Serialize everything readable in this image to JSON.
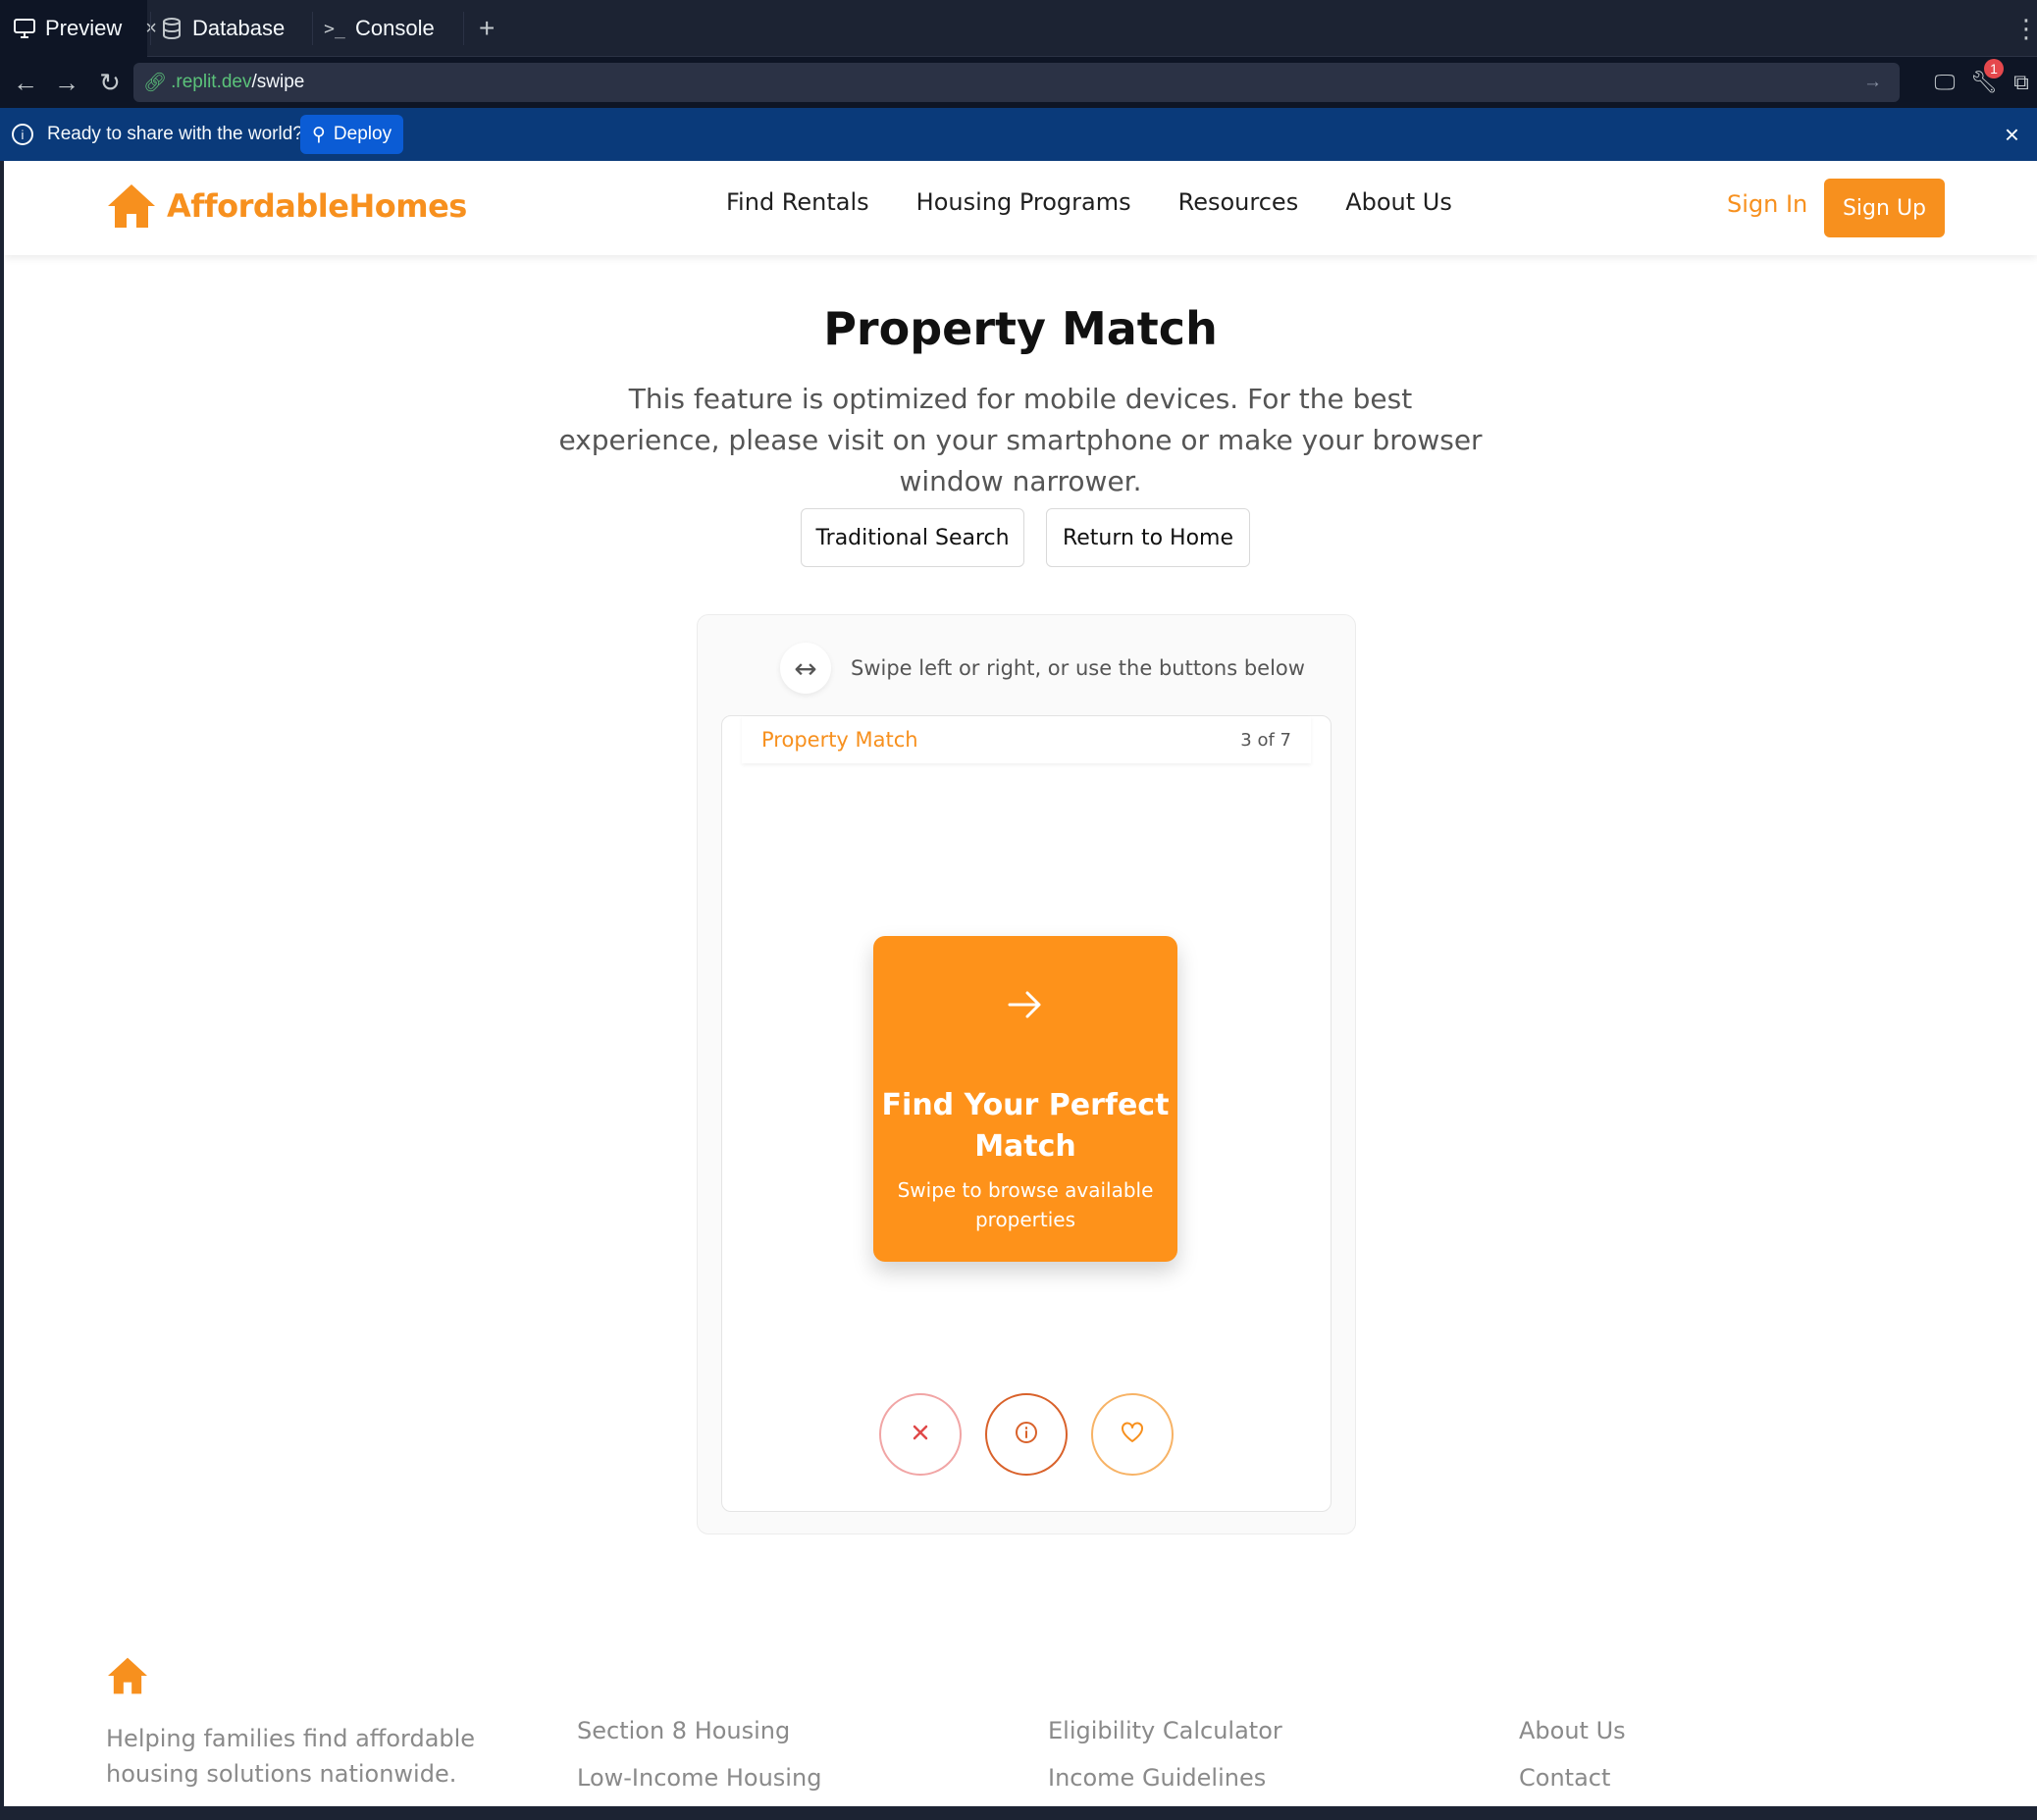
{
  "chrome": {
    "tabs": [
      {
        "label": "Preview",
        "icon": "monitor-icon"
      },
      {
        "label": "Database",
        "icon": "database-icon"
      },
      {
        "label": "Console",
        "icon": "terminal-icon"
      }
    ],
    "url": {
      "domain": ".replit.dev",
      "path": "/swipe"
    },
    "notification_count": "1",
    "deploy_bar": {
      "message": "Ready to share with the world?",
      "button": "Deploy"
    }
  },
  "site": {
    "brand": "AffordableHomes",
    "nav": [
      "Find Rentals",
      "Housing Programs",
      "Resources",
      "About Us"
    ],
    "sign_in": "Sign In",
    "sign_up": "Sign Up"
  },
  "page": {
    "title": "Property Match",
    "subtitle": "This feature is optimized for mobile devices. For the best experience, please visit on your smartphone or make your browser window narrower.",
    "buttons": {
      "traditional_search": "Traditional Search",
      "return_home": "Return to Home"
    },
    "swipe_hint": "Swipe left or right, or use the buttons below",
    "card": {
      "header_title": "Property Match",
      "counter": "3 of 7",
      "promo_title": "Find Your Perfect Match",
      "promo_text": "Swipe to browse available properties"
    },
    "colors": {
      "accent": "#f7901e",
      "reject": "#e04848",
      "info": "#d9622b"
    }
  },
  "footer": {
    "description": "Helping families find affordable housing solutions nationwide.",
    "col1": [
      "Section 8 Housing",
      "Low-Income Housing"
    ],
    "col2": [
      "Eligibility Calculator",
      "Income Guidelines"
    ],
    "col3": [
      "About Us",
      "Contact"
    ]
  }
}
